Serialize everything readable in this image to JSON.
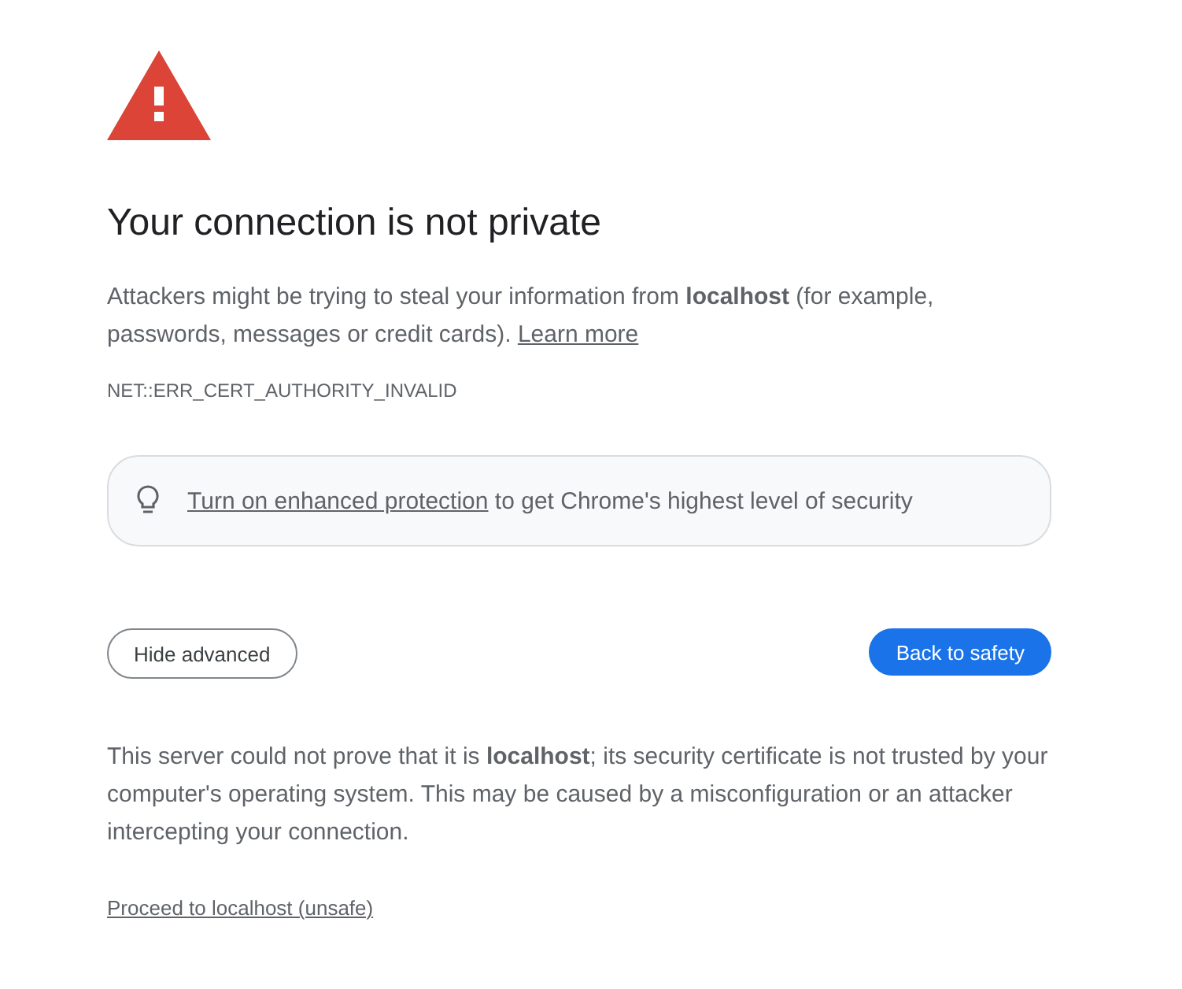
{
  "heading": "Your connection is not private",
  "intro": {
    "text": "Attackers might be trying to steal your information from **localhost** (for example, passwords, messages or credit cards).",
    "link": "Learn more"
  },
  "error_code": "NET::ERR_CERT_AUTHORITY_INVALID",
  "protection_banner": {
    "link": "Turn on enhanced protection",
    "text": "to get Chrome's highest level of security"
  },
  "buttons": [
    {
      "label": "Hide advanced",
      "kind": "secondary"
    },
    {
      "label": "Back to safety",
      "kind": "primary"
    }
  ],
  "details": "This server could not prove that it is **localhost**; its security certificate is not trusted by your computer's operating system. This may be caused by a misconfiguration or an attacker intercepting your connection.",
  "proceed_link": "Proceed to localhost (unsafe)"
}
